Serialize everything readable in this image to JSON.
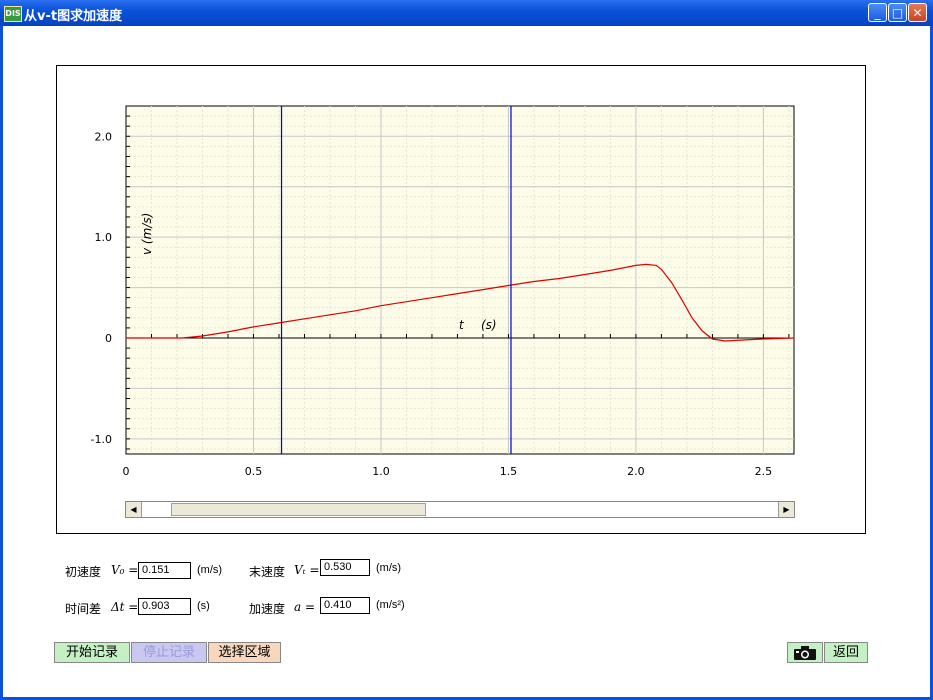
{
  "window": {
    "title": "从v-t图求加速度",
    "icon_text": "DIS"
  },
  "controls": {
    "minimize": "_",
    "maximize": "□",
    "close": "✕"
  },
  "chart_data": {
    "type": "line",
    "ylabel": "v   (m/s)",
    "xlabel_var": "t",
    "xlabel_unit": "(s)",
    "xlim": [
      0,
      2.62
    ],
    "ylim": [
      -1.15,
      2.3
    ],
    "x_ticks": [
      "0",
      "0.5",
      "1.0",
      "1.5",
      "2.0",
      "2.5"
    ],
    "y_ticks": [
      "2.0",
      "1.0",
      "0",
      "-1.0"
    ],
    "grid": true,
    "line_color": "#e00000",
    "cursor_color": "#0000dd",
    "cursors": [
      0.61,
      1.51
    ],
    "series": [
      {
        "x": [
          0,
          0.22,
          0.3,
          0.4,
          0.5,
          0.6,
          0.7,
          0.8,
          0.9,
          1.0,
          1.1,
          1.2,
          1.3,
          1.4,
          1.5,
          1.6,
          1.7,
          1.8,
          1.9,
          2.0,
          2.04,
          2.08,
          2.1,
          2.14,
          2.18,
          2.22,
          2.26,
          2.3,
          2.35,
          2.42,
          2.5,
          2.62
        ],
        "y": [
          0,
          0,
          0.02,
          0.06,
          0.11,
          0.15,
          0.19,
          0.23,
          0.27,
          0.32,
          0.36,
          0.4,
          0.44,
          0.48,
          0.52,
          0.56,
          0.59,
          0.63,
          0.67,
          0.72,
          0.73,
          0.72,
          0.68,
          0.55,
          0.38,
          0.2,
          0.07,
          -0.01,
          -0.03,
          -0.02,
          -0.01,
          0
        ]
      }
    ]
  },
  "readouts": {
    "v0": {
      "label": "初速度",
      "symbol": "V₀ =",
      "value": "0.151",
      "unit": "(m/s)"
    },
    "vt": {
      "label": "末速度",
      "symbol": "Vₜ =",
      "value": "0.530",
      "unit": "(m/s)"
    },
    "dt": {
      "label": "时间差",
      "symbol": "Δt =",
      "value": "0.903",
      "unit": "(s)"
    },
    "a": {
      "label": "加速度",
      "symbol": "a  =",
      "value": "0.410",
      "unit": "(m/s²)"
    }
  },
  "buttons": {
    "start": "开始记录",
    "stop": "停止记录",
    "select": "选择区域",
    "back": "返回",
    "camera_icon": "camera-icon"
  },
  "colors": {
    "start_bg": "#c4f0c4",
    "stop_bg": "#c8c8f0",
    "select_bg": "#f8d8bc",
    "plot_bg": "#fcfce8"
  }
}
